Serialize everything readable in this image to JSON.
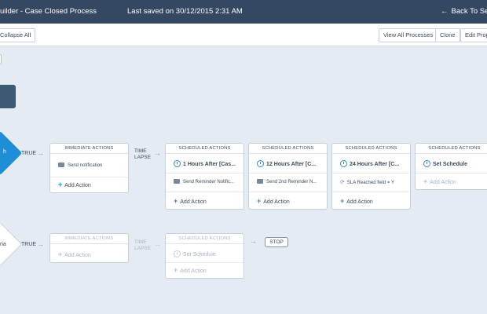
{
  "header": {
    "title": "uilder - Case Closed Process",
    "last_saved": "Last saved on 30/12/2015 2:31 AM",
    "back_label": "Back To Setu",
    "back_arrow": "←"
  },
  "toolbar": {
    "collapse_all": "Collapse All",
    "view_all_processes": "View All Processes",
    "clone": "Clone",
    "edit_properties": "Edit Prop"
  },
  "criteria": {
    "first_label": "h",
    "second_label": "ria"
  },
  "connectors": {
    "true_label": "TRUE",
    "time_lapse_line1": "TIME",
    "time_lapse_line2": "LAPSE",
    "arrow": "→"
  },
  "row1": {
    "immediate": {
      "header": "IMMEDIATE ACTIONS",
      "action": "Send notification",
      "add": "Add Action"
    },
    "scheduled": [
      {
        "header": "SCHEDULED ACTIONS",
        "schedule": "1 Hours After [Cas...",
        "action": "Send Reminder Notific...",
        "add": "Add Action",
        "action_icon": "mail-icon"
      },
      {
        "header": "SCHEDULED ACTIONS",
        "schedule": "12 Hours After [C...",
        "action": "Send 2nd Reminder N...",
        "add": "Add Action",
        "action_icon": "mail-icon"
      },
      {
        "header": "SCHEDULED ACTIONS",
        "schedule": "24 Hours After [C...",
        "action": "SLA Reached field = Y",
        "add": "Add Action",
        "action_icon": "sync-icon"
      },
      {
        "header": "SCHEDULED ACTIONS",
        "schedule": "Set Schedule",
        "add": "Add Action"
      }
    ]
  },
  "row2": {
    "immediate": {
      "header": "IMMEDIATE ACTIONS",
      "add": "Add Action"
    },
    "scheduled": {
      "header": "SCHEDULED ACTIONS",
      "schedule": "Set Schedule",
      "add": "Add Action"
    },
    "stop": "STOP"
  },
  "colors": {
    "topbar": "#344861",
    "accent": "#1e8fd6",
    "canvas": "#e4ebf3"
  }
}
